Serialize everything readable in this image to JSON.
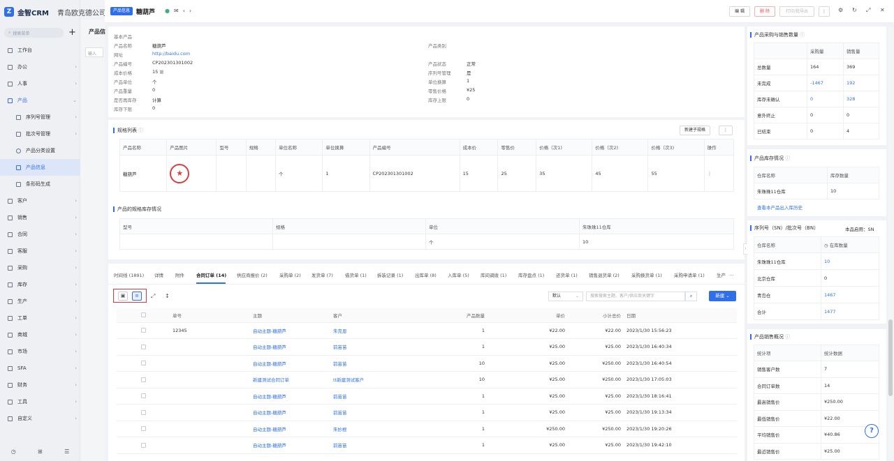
{
  "app": {
    "logo_text": "金智CRM",
    "company": "青岛欧克德公司",
    "logo_glyph": "Z"
  },
  "sidebar": {
    "search_placeholder": "搜索菜单",
    "items": [
      {
        "label": "工作台",
        "arrow": ""
      },
      {
        "label": "办公",
        "arrow": "›"
      },
      {
        "label": "人事",
        "arrow": "›"
      },
      {
        "label": "产品",
        "arrow": "⌄"
      },
      {
        "label": "序列号管理",
        "arrow": "›"
      },
      {
        "label": "批次号管理",
        "arrow": "›"
      },
      {
        "label": "产品分类设置",
        "arrow": ""
      },
      {
        "label": "产品信息",
        "arrow": ""
      },
      {
        "label": "条形码生成",
        "arrow": ""
      },
      {
        "label": "客户",
        "arrow": "›"
      },
      {
        "label": "销售",
        "arrow": "›"
      },
      {
        "label": "合同",
        "arrow": "›"
      },
      {
        "label": "客服",
        "arrow": "›"
      },
      {
        "label": "采购",
        "arrow": "›"
      },
      {
        "label": "库存",
        "arrow": "›"
      },
      {
        "label": "生产",
        "arrow": "›"
      },
      {
        "label": "工单",
        "arrow": "›"
      },
      {
        "label": "商城",
        "arrow": "›"
      },
      {
        "label": "市场",
        "arrow": "›"
      },
      {
        "label": "SFA",
        "arrow": "›"
      },
      {
        "label": "财务",
        "arrow": "›"
      },
      {
        "label": "工具",
        "arrow": "›"
      },
      {
        "label": "自定义",
        "arrow": "›"
      }
    ]
  },
  "ghost": {
    "title": "产品信",
    "input": "输入"
  },
  "header": {
    "badge": "产品信息",
    "title": "糖葫芦",
    "edit": "编 辑",
    "delete": "删 除",
    "print": "打印/批导出",
    "more": "⋮"
  },
  "basic": {
    "section": "基本产品",
    "left": [
      {
        "label": "产品名称",
        "value": "糖葫芦"
      },
      {
        "label": "网址",
        "value": "http://baidu.com"
      },
      {
        "label": "产品编号",
        "value": "CP202301301002"
      },
      {
        "label": "成本价格",
        "value": "15"
      },
      {
        "label": "产品单位",
        "value": "个"
      },
      {
        "label": "产品重量",
        "value": "0"
      },
      {
        "label": "是否再库存",
        "value": "计算"
      },
      {
        "label": "库存下限",
        "value": "0"
      }
    ],
    "right": [
      {
        "label": "产品类别",
        "value": ""
      },
      {
        "label": "产品状态",
        "value": "正常"
      },
      {
        "label": "序列号管理",
        "value": "是"
      },
      {
        "label": "单位换算",
        "value": "1"
      },
      {
        "label": "零售价格",
        "value": "¥25"
      },
      {
        "label": "库存上限",
        "value": "0"
      }
    ]
  },
  "spec": {
    "title": "规格列表",
    "new_btn": "新建子规格",
    "headers": [
      "产品名称",
      "产品图片",
      "型号",
      "规格",
      "单位名称",
      "单位换算",
      "产品编号",
      "成本价",
      "零售价",
      "价格（次1)",
      "价格（次2)",
      "价格（次3)",
      "操作"
    ],
    "row": [
      "糖葫芦",
      "",
      "",
      "",
      "个",
      "1",
      "CP202301301002",
      "15",
      "25",
      "35",
      "45",
      "55",
      "⋮"
    ]
  },
  "spec_stock": {
    "title": "产品的规格库存情况",
    "headers": [
      "型号",
      "规格",
      "单位",
      "朱珠珠11仓库"
    ],
    "row": [
      "",
      "",
      "个",
      "10"
    ]
  },
  "tabs": [
    "时间线 (1891)",
    "详情",
    "附件",
    "合同订单 (14)",
    "供应商报价 (2)",
    "采购单 (2)",
    "发货单 (7)",
    "借货单 (1)",
    "拆装记录 (1)",
    "出库单 (8)",
    "入库单 (5)",
    "库间调拨 (1)",
    "库存盘点 (1)",
    "还货单 (1)",
    "销售退货单 (2)",
    "采购换货单 (1)",
    "采购申请单 (1)",
    "生产",
    "…"
  ],
  "orders": {
    "sort": "默认",
    "search_placeholder": "搜索搜索主题、客户/供应商关键字",
    "new_btn": "新建",
    "headers": [
      "单号",
      "主题",
      "客户",
      "产品数量",
      "单价",
      "小计总价",
      "日期"
    ],
    "rows": [
      [
        "12345",
        "自动主题-糖葫芦",
        "朱克恩",
        "1",
        "¥22.00",
        "¥22.00",
        "2023/1/30 15:56:23"
      ],
      [
        "",
        "自动主题-糖葫芦",
        "前苗苗",
        "1",
        "¥25.00",
        "¥25.00",
        "2023/1/30 16:40:34"
      ],
      [
        "",
        "自动主题-糖葫芦",
        "前苗苗",
        "10",
        "¥25.00",
        "¥250.00",
        "2023/1/30 16:40:54"
      ],
      [
        "",
        "新建测试合同订单",
        "tt新建测试客户",
        "10",
        "¥25.00",
        "¥250.00",
        "2023/1/30 17:05:03"
      ],
      [
        "",
        "自动主题-糖葫芦",
        "前苗苗",
        "1",
        "¥25.00",
        "¥25.00",
        "2023/1/30 18:16:41"
      ],
      [
        "",
        "自动主题-糖葫芦",
        "前苗苗",
        "1",
        "¥25.00",
        "¥25.00",
        "2023/1/30 19:13:34"
      ],
      [
        "",
        "自动主题-糖葫芦",
        "朱妙根",
        "1",
        "¥250.00",
        "¥250.00",
        "2023/1/30 19:20:26"
      ],
      [
        "",
        "自动主题-糖葫芦",
        "前苗苗",
        "1",
        "¥25.00",
        "¥25.00",
        "2023/1/30 19:42:10"
      ]
    ]
  },
  "purchase_sales": {
    "title": "产品采购与销售数量",
    "headers": [
      "",
      "采购量",
      "销售量"
    ],
    "rows": [
      [
        "总数量",
        "164",
        "369"
      ],
      [
        "未完成",
        "-1467",
        "192"
      ],
      [
        "库存未确认",
        "0",
        "328"
      ],
      [
        "意外终止",
        "0",
        "0"
      ],
      [
        "已结束",
        "0",
        "4"
      ]
    ]
  },
  "stock": {
    "title": "产品库存情况",
    "headers": [
      "仓库名称",
      "库存数量"
    ],
    "rows": [
      [
        "朱珠珠11仓库",
        "10"
      ]
    ],
    "link": "查看本产品出入库历史"
  },
  "sn": {
    "title": "序列号（SN）/批次号（BN）",
    "enabled": "本品启用：SN",
    "headers": [
      "仓库名称",
      "在库数量"
    ],
    "rows": [
      [
        "朱珠珠11仓库",
        "10"
      ],
      [
        "北京仓库",
        "0"
      ],
      [
        "青岛仓",
        "1467"
      ],
      [
        "合计",
        "1477"
      ]
    ]
  },
  "sales_overview": {
    "title": "产品销售概况",
    "headers": [
      "统计项",
      "统计数据"
    ],
    "rows": [
      [
        "销售客户数",
        "7"
      ],
      [
        "合同订单数",
        "14"
      ],
      [
        "最高销售价",
        "¥250.00"
      ],
      [
        "最低销售价",
        "¥22.00"
      ],
      [
        "平均销售价",
        "¥40.86"
      ],
      [
        "最近销售价",
        "¥25.00"
      ]
    ]
  },
  "help": "?"
}
